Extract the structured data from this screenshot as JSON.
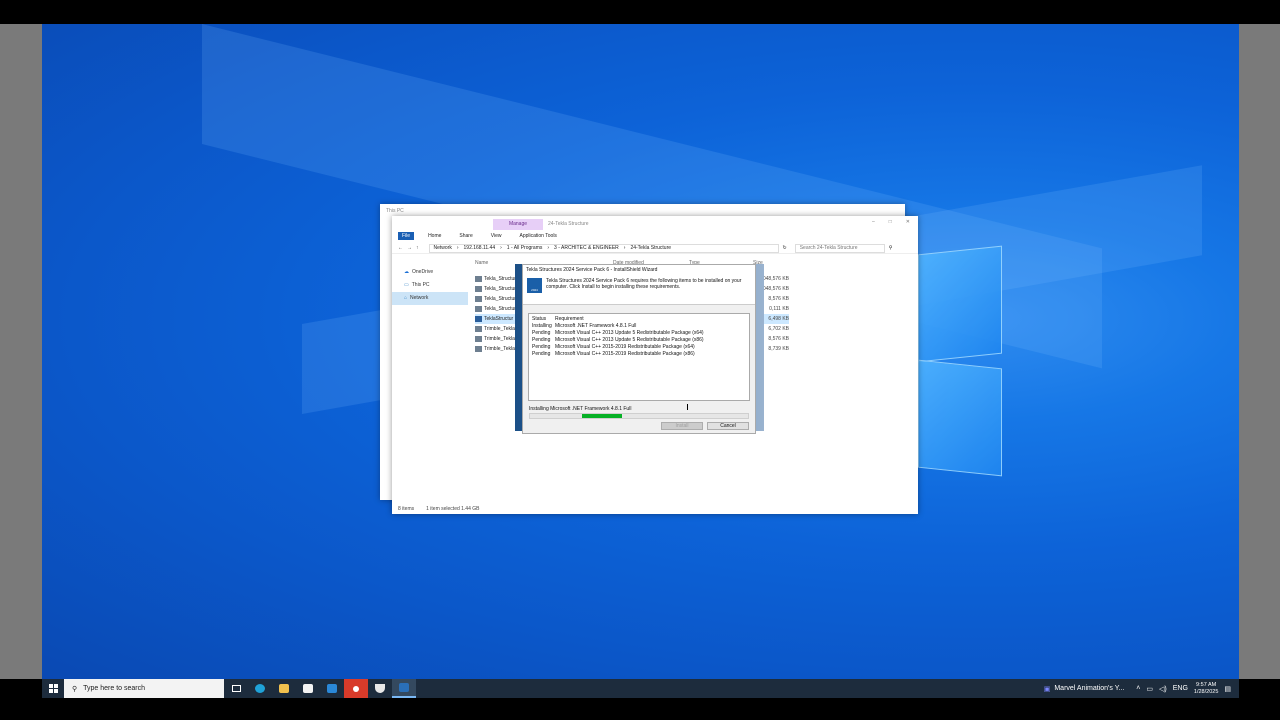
{
  "explorer_back": {
    "title": "This PC"
  },
  "explorer": {
    "context_tab": "Manage",
    "context_title": "24-Tekla Structure",
    "ribbon_tabs": [
      "File",
      "Home",
      "Share",
      "View",
      "Application Tools"
    ],
    "breadcrumb": [
      "Network",
      "192.168.11.44",
      "1 - All Programs",
      "3 - ARCHITEC & ENGINEER",
      "24-Tekla Structure"
    ],
    "search_placeholder": "Search 24-Tekla Structure",
    "nav": [
      "OneDrive",
      "This PC",
      "Network"
    ],
    "columns": [
      "Name",
      "Date modified",
      "Type",
      "Size"
    ],
    "files": [
      {
        "name": "Tekla_Structures",
        "size": "1,048,576 KB"
      },
      {
        "name": "Tekla_Structures",
        "size": "1,048,576 KB"
      },
      {
        "name": "Tekla_Structur",
        "size": "8,576 KB"
      },
      {
        "name": "Tekla_Structur",
        "size": "0,111 KB"
      },
      {
        "name": "TeklaStructur",
        "size": "6,498 KB"
      },
      {
        "name": "Trimble_Tekla",
        "size": "6,702 KB"
      },
      {
        "name": "Trimble_Tekla",
        "size": "8,576 KB"
      },
      {
        "name": "Trimble_Tekla",
        "size": "8,739 KB"
      }
    ],
    "status_items": "8 items",
    "status_selected": "1 item selected  1.44 GB"
  },
  "installer": {
    "title": "Tekla Structures 2024 Service Pack 6 - InstallShield Wizard",
    "logo_text": "2024",
    "description": "Tekla Structures 2024 Service Pack 6 requires the following items to be installed on your computer. Click Install to begin installing these requirements.",
    "col_status": "Status",
    "col_requirement": "Requirement",
    "requirements": [
      {
        "status": "Installing",
        "name": "Microsoft .NET Framework 4.8.1 Full"
      },
      {
        "status": "Pending",
        "name": "Microsoft Visual C++ 2013 Update 5 Redistributable Package (x64)"
      },
      {
        "status": "Pending",
        "name": "Microsoft Visual C++ 2013 Update 5 Redistributable Package (x86)"
      },
      {
        "status": "Pending",
        "name": "Microsoft Visual C++ 2015-2019 Redistributable Package (x64)"
      },
      {
        "status": "Pending",
        "name": "Microsoft Visual C++ 2015-2019 Redistributable Package (x86)"
      }
    ],
    "status_text": "Installing Microsoft .NET Framework 4.8.1 Full",
    "progress_fraction": 0.18,
    "progress_start_fraction": 0.24,
    "install_label": "Install",
    "cancel_label": "Cancel"
  },
  "taskbar": {
    "search_placeholder": "Type here to search",
    "youtube_label": "Marvel Animation's Y...",
    "lang": "ENG",
    "time": "9:57 AM",
    "date": "1/28/2025"
  }
}
